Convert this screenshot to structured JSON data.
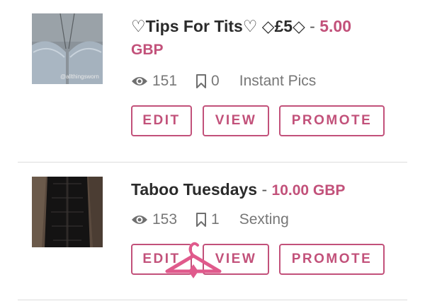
{
  "listings": [
    {
      "title": "♡Tips For Tits♡ ◇£5◇",
      "separator": "-",
      "price_amount": "5.00",
      "price_currency": "GBP",
      "views": "151",
      "bookmarks": "0",
      "category": "Instant Pics",
      "thumbnail_text": "@allthingsworn",
      "buttons": {
        "edit": "EDIT",
        "view": "VIEW",
        "promote": "PROMOTE"
      }
    },
    {
      "title": "Taboo Tuesdays",
      "separator": "-",
      "price": "10.00 GBP",
      "views": "153",
      "bookmarks": "1",
      "category": "Sexting",
      "buttons": {
        "edit": "EDIT",
        "view": "VIEW",
        "promote": "PROMOTE"
      }
    }
  ],
  "colors": {
    "accent": "#c2517a",
    "text": "#2b2b2b",
    "muted": "#777777",
    "divider": "#dcdcdc"
  },
  "icons": {
    "views": "eye-icon",
    "bookmarks": "bookmark-icon"
  }
}
